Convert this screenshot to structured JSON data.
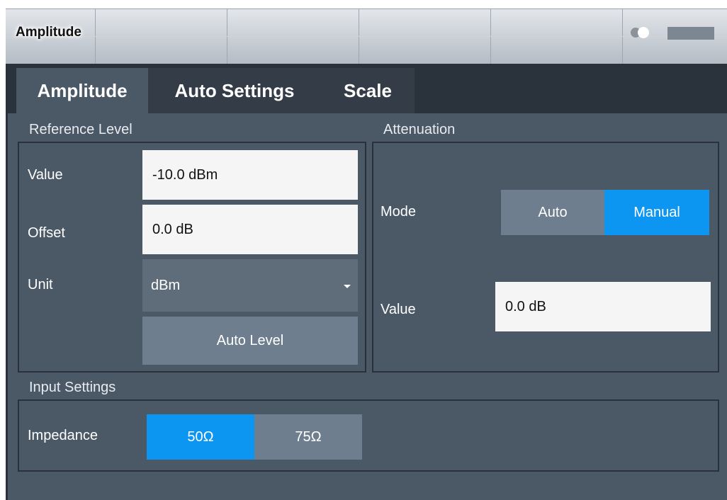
{
  "window": {
    "title": "Amplitude"
  },
  "tabs": [
    {
      "label": "Amplitude",
      "active": true
    },
    {
      "label": "Auto Settings",
      "active": false
    },
    {
      "label": "Scale",
      "active": false
    }
  ],
  "reference_level": {
    "section_label": "Reference Level",
    "value_label": "Value",
    "value": "-10.0 dBm",
    "offset_label": "Offset",
    "offset": "0.0 dB",
    "unit_label": "Unit",
    "unit": "dBm",
    "auto_level_label": "Auto Level"
  },
  "attenuation": {
    "section_label": "Attenuation",
    "mode_label": "Mode",
    "mode_options": [
      "Auto",
      "Manual"
    ],
    "mode_selected": "Manual",
    "value_label": "Value",
    "value": "0.0 dB"
  },
  "input_settings": {
    "section_label": "Input Settings",
    "impedance_label": "Impedance",
    "impedance_options": [
      "50Ω",
      "75Ω"
    ],
    "impedance_selected": "50Ω"
  },
  "colors": {
    "panel_bg": "#4b5866",
    "tab_strip_bg": "#2a323b",
    "selected_blue": "#0d95f2",
    "button_gray": "#6e7e8f",
    "field_bg": "#f5f5f5"
  },
  "icons": {
    "titlebar_toggle": "toggle-icon",
    "titlebar_bar": "bar-icon",
    "unit_dropdown": "chevron-down-icon"
  }
}
